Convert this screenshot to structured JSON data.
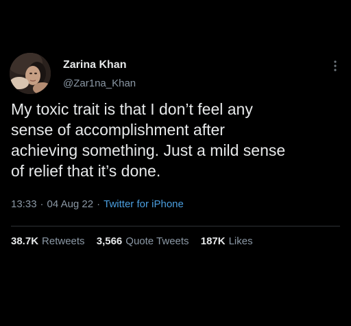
{
  "author": {
    "display_name": "Zarina Khan",
    "handle": "@Zar1na_Khan"
  },
  "tweet": {
    "lines": [
      "My toxic trait is that I don’t feel any",
      "sense of accomplishment after",
      "achieving something. Just a mild sense",
      "of relief that it’s done."
    ],
    "time": "13:33",
    "date": "04 Aug 22",
    "separator": "·",
    "source": "Twitter for iPhone"
  },
  "stats": {
    "retweets_count": "38.7K",
    "retweets_label": "Retweets",
    "quotes_count": "3,566",
    "quotes_label": "Quote Tweets",
    "likes_count": "187K",
    "likes_label": "Likes"
  },
  "icons": {
    "more": "more-vertical-icon",
    "avatar": "profile-photo"
  },
  "colors": {
    "background": "#000000",
    "primary_text": "#e7e9ea",
    "secondary_text": "#8b98a5",
    "link": "#4b9fe0",
    "divider": "#2f3336"
  }
}
